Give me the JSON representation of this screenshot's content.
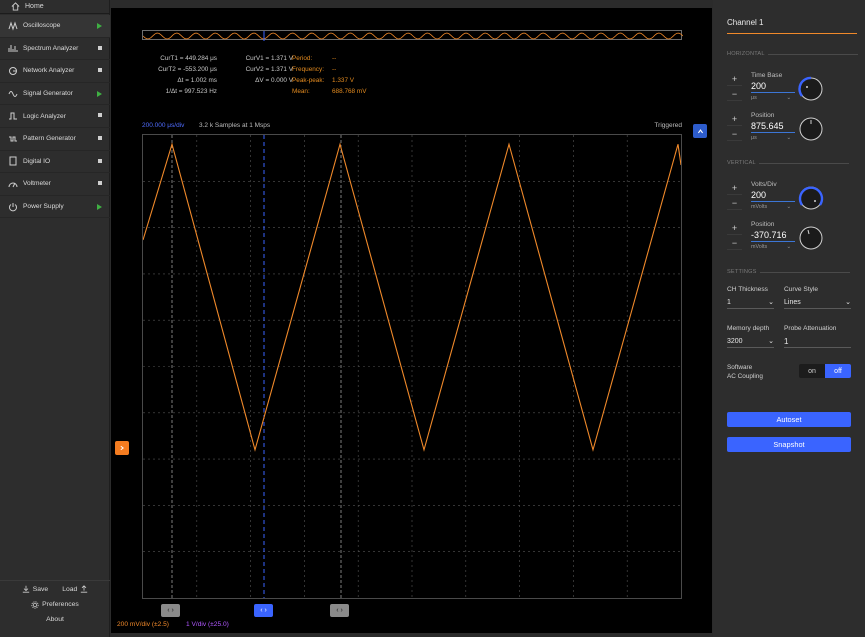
{
  "sidebar": {
    "home": "Home",
    "items": [
      {
        "label": "Oscilloscope",
        "icon": "oscilloscope-icon",
        "status": "running",
        "active": true
      },
      {
        "label": "Spectrum Analyzer",
        "icon": "spectrum-icon",
        "status": "stopped"
      },
      {
        "label": "Network Analyzer",
        "icon": "network-icon",
        "status": "stopped"
      },
      {
        "label": "Signal Generator",
        "icon": "signal-icon",
        "status": "running"
      },
      {
        "label": "Logic Analyzer",
        "icon": "logic-icon",
        "status": "stopped"
      },
      {
        "label": "Pattern Generator",
        "icon": "pattern-icon",
        "status": "stopped"
      },
      {
        "label": "Digital IO",
        "icon": "digital-io-icon",
        "status": "stopped"
      },
      {
        "label": "Voltmeter",
        "icon": "voltmeter-icon",
        "status": "stopped"
      },
      {
        "label": "Power Supply",
        "icon": "power-icon",
        "status": "running"
      }
    ],
    "save": "Save",
    "load": "Load",
    "preferences": "Preferences",
    "about": "About"
  },
  "cursors": {
    "rows": [
      [
        "CurT1 = 449.284 μs",
        "CurV1 = 1.371 V"
      ],
      [
        "CurT2 = -553.200 μs",
        "CurV2 = 1.371 V"
      ],
      [
        "Δt = 1.002 ms",
        "ΔV = 0.000 V"
      ],
      [
        "1/Δt = 997.523 Hz",
        ""
      ]
    ]
  },
  "measurements": [
    {
      "k": "Period:",
      "v": "--"
    },
    {
      "k": "Frequency:",
      "v": "--"
    },
    {
      "k": "Peak-peak:",
      "v": "1.337 V"
    },
    {
      "k": "Mean:",
      "v": "688.768 mV"
    }
  ],
  "plot": {
    "time_div": "200.000 μs/div",
    "samples": "3.2 k Samples at 1 Msps",
    "trigger_status": "Triggered",
    "ch1_scale": "200 mV/div (±2.5)",
    "ch2_scale": "1 V/div (±25.0)",
    "colors": {
      "ch1": "#f0892a",
      "cursor": "#3a64ff",
      "grid": "#555555"
    },
    "waveform": {
      "type": "triangle",
      "peaks_y_frac": 0.02,
      "troughs_y_frac": 0.68
    }
  },
  "panel": {
    "channel": "Channel 1",
    "horizontal": "HORIZONTAL",
    "vertical": "VERTICAL",
    "settings": "SETTINGS",
    "time_base": {
      "label": "Time Base",
      "value": "200",
      "unit": "μs"
    },
    "h_position": {
      "label": "Position",
      "value": "875.645",
      "unit": "μs"
    },
    "volts_div": {
      "label": "Volts/Div",
      "value": "200",
      "unit": "mVolts"
    },
    "v_position": {
      "label": "Position",
      "value": "-370.716",
      "unit": "mVolts"
    },
    "ch_thickness": {
      "label": "CH Thickness",
      "value": "1"
    },
    "curve_style": {
      "label": "Curve Style",
      "value": "Lines"
    },
    "memory_depth": {
      "label": "Memory depth",
      "value": "3200"
    },
    "probe_att": {
      "label": "Probe Attenuation",
      "value": "1"
    },
    "ac_coupling": {
      "label1": "Software",
      "label2": "AC Coupling",
      "on": "on",
      "off": "off"
    },
    "autoset": "Autoset",
    "snapshot": "Snapshot"
  }
}
